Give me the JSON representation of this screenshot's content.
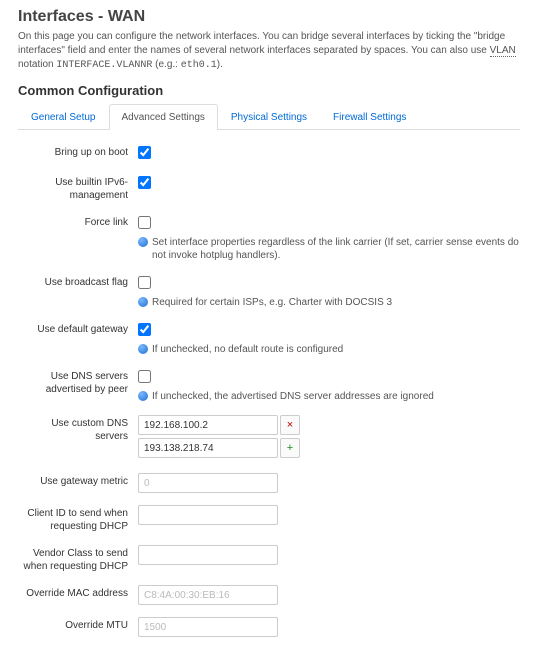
{
  "page": {
    "title": "Interfaces - WAN",
    "desc_pre": "On this page you can configure the network interfaces. You can bridge several interfaces by ticking the \"bridge interfaces\" field and enter the names of several network interfaces separated by spaces. You can also use ",
    "desc_abbr": "VLAN",
    "desc_mid": " notation ",
    "desc_code1": "INTERFACE.VLANNR",
    "desc_eg": " (e.g.: ",
    "desc_code2": "eth0.1",
    "desc_end": ")."
  },
  "section_heading": "Common Configuration",
  "tabs": {
    "general": "General Setup",
    "advanced": "Advanced Settings",
    "physical": "Physical Settings",
    "firewall": "Firewall Settings"
  },
  "fields": {
    "bring_up": {
      "label": "Bring up on boot",
      "checked": true
    },
    "ipv6_mgmt": {
      "label": "Use builtin IPv6-management",
      "checked": true
    },
    "force_link": {
      "label": "Force link",
      "checked": false,
      "hint": "Set interface properties regardless of the link carrier (If set, carrier sense events do not invoke hotplug handlers)."
    },
    "broadcast": {
      "label": "Use broadcast flag",
      "checked": false,
      "hint": "Required for certain ISPs, e.g. Charter with DOCSIS 3"
    },
    "default_gw": {
      "label": "Use default gateway",
      "checked": true,
      "hint": "If unchecked, no default route is configured"
    },
    "dns_peer": {
      "label": "Use DNS servers advertised by peer",
      "checked": false,
      "hint": "If unchecked, the advertised DNS server addresses are ignored"
    },
    "custom_dns": {
      "label": "Use custom DNS servers",
      "servers": [
        "192.168.100.2",
        "193.138.218.74"
      ]
    },
    "gw_metric": {
      "label": "Use gateway metric",
      "placeholder": "0"
    },
    "client_id": {
      "label": "Client ID to send when requesting DHCP",
      "value": ""
    },
    "vendor_class": {
      "label": "Vendor Class to send when requesting DHCP",
      "value": ""
    },
    "override_mac": {
      "label": "Override MAC address",
      "placeholder": "C8:4A:00:30:EB:16"
    },
    "override_mtu": {
      "label": "Override MTU",
      "placeholder": "1500"
    }
  }
}
